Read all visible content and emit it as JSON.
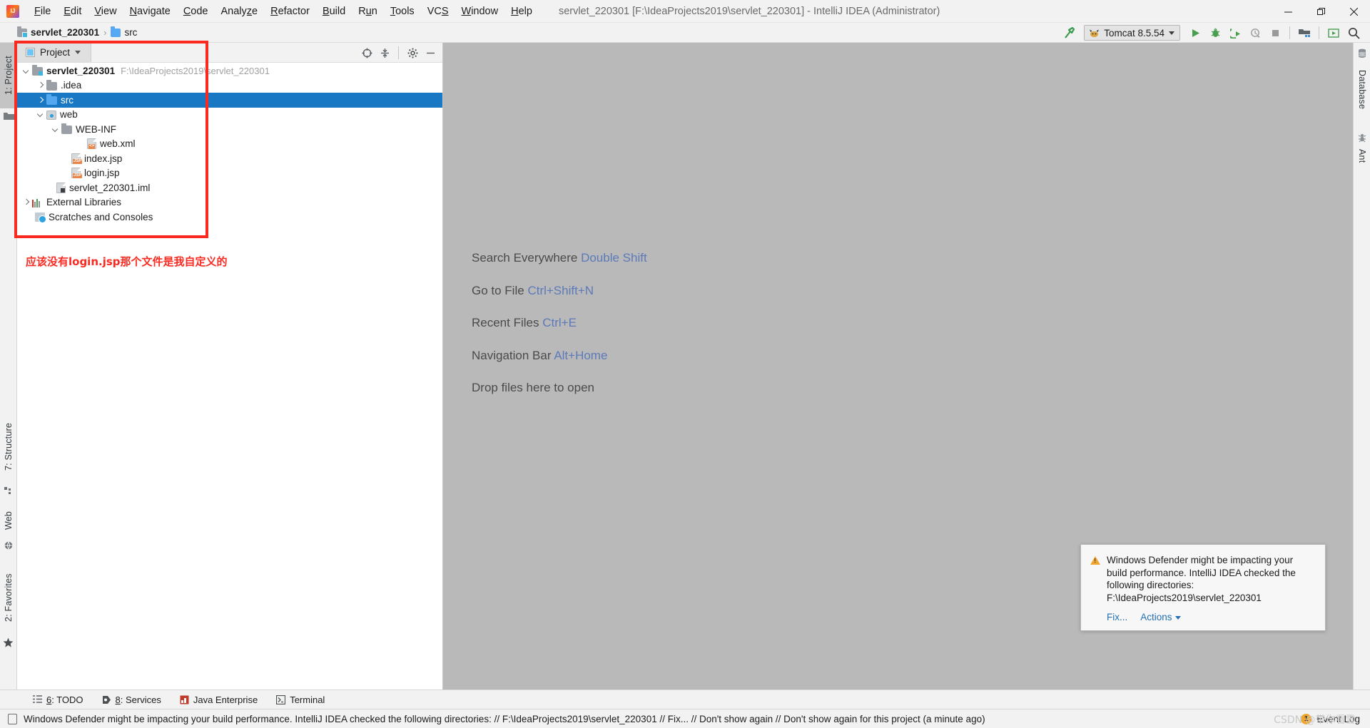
{
  "window": {
    "title": "servlet_220301 [F:\\IdeaProjects2019\\servlet_220301] - IntelliJ IDEA (Administrator)",
    "app_logo": "intellij-idea-logo",
    "minimize": "—",
    "restore": "❐",
    "close": "✕"
  },
  "menubar": {
    "items": [
      {
        "label": "File"
      },
      {
        "label": "Edit"
      },
      {
        "label": "View"
      },
      {
        "label": "Navigate"
      },
      {
        "label": "Code"
      },
      {
        "label": "Analyze"
      },
      {
        "label": "Refactor"
      },
      {
        "label": "Build"
      },
      {
        "label": "Run"
      },
      {
        "label": "Tools"
      },
      {
        "label": "VCS"
      },
      {
        "label": "Window"
      },
      {
        "label": "Help"
      }
    ]
  },
  "navbar": {
    "breadcrumbs": [
      {
        "label": "servlet_220301",
        "icon": "folder-module-icon"
      },
      {
        "label": "src",
        "icon": "folder-source-icon"
      }
    ],
    "separator": "›",
    "run_config": {
      "label": "Tomcat 8.5.54",
      "icon": "tomcat-cat-icon"
    },
    "buttons": [
      {
        "name": "build-hammer-icon",
        "glyph": "⤴"
      },
      {
        "name": "run-button",
        "glyph": "▶"
      },
      {
        "name": "debug-button",
        "glyph": "ὁE"
      },
      {
        "name": "run-with-coverage-button",
        "glyph": "⮞"
      },
      {
        "name": "profile-button",
        "glyph": "◴"
      },
      {
        "name": "stop-button",
        "glyph": "■"
      },
      {
        "name": "project-structure-button",
        "glyph": "▦"
      },
      {
        "name": "update-project-button",
        "glyph": "▣"
      },
      {
        "name": "search-everywhere-button",
        "glyph": "⚲"
      }
    ]
  },
  "left_strip": {
    "tabs": [
      {
        "label": "1: Project",
        "selected": true,
        "icon": "project-folder-icon"
      },
      {
        "label": "7: Structure",
        "selected": false,
        "icon": "structure-icon"
      },
      {
        "label": "Web",
        "selected": false,
        "icon": "web-globe-icon"
      },
      {
        "label": "2: Favorites",
        "selected": false,
        "icon": "star-icon"
      }
    ]
  },
  "right_strip": {
    "tabs": [
      {
        "label": "Database",
        "icon": "database-icon"
      },
      {
        "label": "Ant",
        "icon": "ant-icon"
      }
    ]
  },
  "project_panel": {
    "tab_label": "Project",
    "tools": [
      {
        "name": "scroll-from-source-icon",
        "glyph": "⊕"
      },
      {
        "name": "collapse-all-icon",
        "glyph": "↥"
      },
      {
        "name": "settings-gear-icon",
        "glyph": "⚙"
      },
      {
        "name": "hide-panel-icon",
        "glyph": "—"
      }
    ],
    "tree": [
      {
        "label": "servlet_220301",
        "path": "F:\\IdeaProjects2019\\servlet_220301",
        "indent": 0,
        "arrow": "down",
        "icon": "folder-module-icon",
        "bold": true,
        "selected": false
      },
      {
        "label": ".idea",
        "indent": 1,
        "arrow": "right",
        "icon": "folder-icon",
        "bold": false,
        "selected": false
      },
      {
        "label": "src",
        "indent": 1,
        "arrow": "right",
        "icon": "folder-source-icon",
        "bold": false,
        "selected": true
      },
      {
        "label": "web",
        "indent": 1,
        "arrow": "down",
        "icon": "web-root-icon",
        "bold": false,
        "selected": false
      },
      {
        "label": "WEB-INF",
        "indent": 2,
        "arrow": "down",
        "icon": "folder-icon",
        "bold": false,
        "selected": false
      },
      {
        "label": "web.xml",
        "indent": 3,
        "arrow": "none",
        "icon": "xml-file-icon",
        "bold": false,
        "selected": false
      },
      {
        "label": "index.jsp",
        "indent": 2,
        "arrow": "none",
        "icon": "jsp-file-icon",
        "bold": false,
        "selected": false
      },
      {
        "label": "login.jsp",
        "indent": 2,
        "arrow": "none",
        "icon": "jsp-file-icon",
        "bold": false,
        "selected": false
      },
      {
        "label": "servlet_220301.iml",
        "indent": 1,
        "arrow": "none",
        "icon": "iml-file-icon",
        "bold": false,
        "selected": false
      },
      {
        "label": "External Libraries",
        "indent": 0,
        "arrow": "right",
        "icon": "libraries-icon",
        "bold": false,
        "selected": false
      },
      {
        "label": "Scratches and Consoles",
        "indent": 0,
        "arrow": "none",
        "icon": "scratches-icon",
        "bold": false,
        "selected": false
      }
    ]
  },
  "editor": {
    "hints": [
      {
        "action": "Search Everywhere",
        "shortcut": "Double Shift"
      },
      {
        "action": "Go to File",
        "shortcut": "Ctrl+Shift+N"
      },
      {
        "action": "Recent Files",
        "shortcut": "Ctrl+E"
      },
      {
        "action": "Navigation Bar",
        "shortcut": "Alt+Home"
      },
      {
        "action": "Drop files here to open",
        "shortcut": ""
      }
    ]
  },
  "notification": {
    "icon": "warning-triangle-icon",
    "message": "Windows Defender might be impacting your build performance. IntelliJ IDEA checked the following directories:",
    "path": "F:\\IdeaProjects2019\\servlet_220301",
    "links": [
      {
        "label": "Fix..."
      },
      {
        "label": "Actions"
      }
    ]
  },
  "bottom_strip": {
    "tabs": [
      {
        "label": "6: TODO",
        "icon": "todo-list-icon"
      },
      {
        "label": "8: Services",
        "icon": "services-icon"
      },
      {
        "label": "Java Enterprise",
        "icon": "java-enterprise-icon"
      },
      {
        "label": "Terminal",
        "icon": "terminal-icon"
      }
    ]
  },
  "status_bar": {
    "icon": "notification-balloon-icon",
    "message": "Windows Defender might be impacting your build performance. IntelliJ IDEA checked the following directories: // F:\\IdeaProjects2019\\servlet_220301 // Fix... // Don't show again // Don't show again for this project (a minute ago)",
    "event_log_count": "1",
    "event_log_label": "Event Log"
  },
  "annotations": {
    "note_text": "应该没有login.jsp那个文件是我自定义的",
    "highlight_color": "#fb2a21",
    "watermark": "CSDN @带你看雪."
  },
  "colors": {
    "selection": "#1978c4",
    "editor_bg": "#b9b9b9",
    "chrome_bg": "#f2f2f2",
    "link": "#5c79b9",
    "accent_red": "#fb2a21"
  }
}
